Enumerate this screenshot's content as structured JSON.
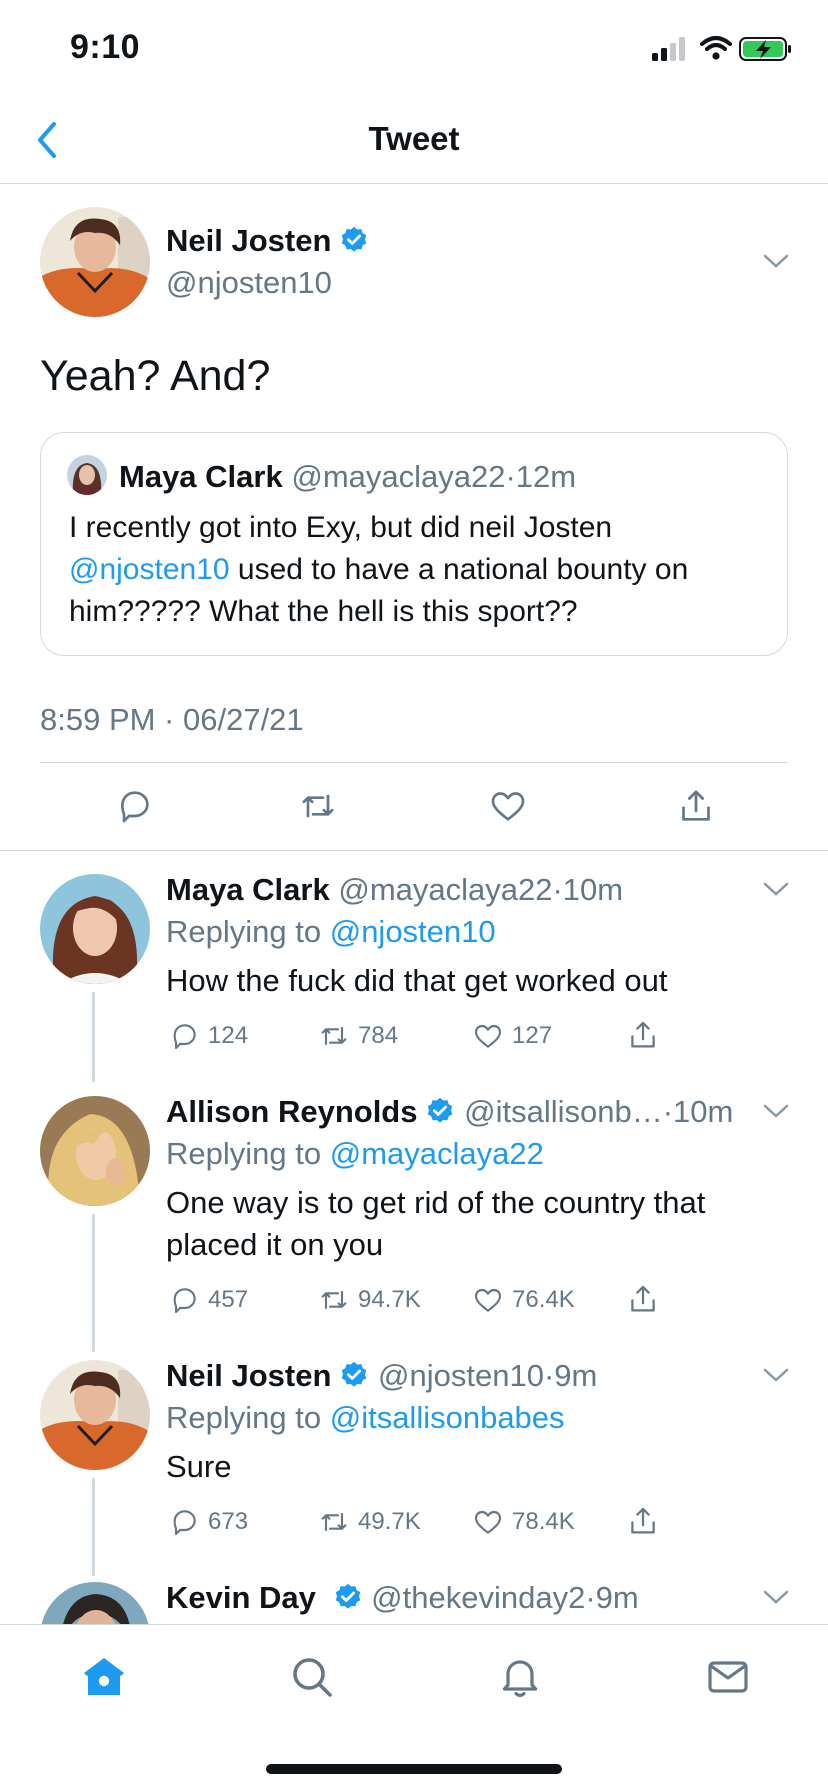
{
  "status_bar": {
    "time": "9:10"
  },
  "nav": {
    "title": "Tweet"
  },
  "main_tweet": {
    "author_name": "Neil Josten",
    "author_handle": "@njosten10",
    "text": "Yeah? And?",
    "quote": {
      "author_name": "Maya Clark",
      "author_handle": "@mayaclaya22",
      "time": "12m",
      "text_1": "I recently got into Exy, but did neil Josten",
      "mention": "@njosten10",
      "text_2": "used to have a national bounty on",
      "text_3": "him????? What the hell is this sport??"
    },
    "timestamp": "8:59 PM · 06/27/21"
  },
  "replies": [
    {
      "author_name": "Maya Clark",
      "author_handle": "@mayaclaya22",
      "time": "10m",
      "replying_prefix": "Replying to",
      "replying_to": "@njosten10",
      "text": "How the fuck did that get worked out",
      "comments": "124",
      "retweets": "784",
      "likes": "127"
    },
    {
      "author_name": "Allison Reynolds",
      "author_handle": "@itsallisonb…",
      "time": "10m",
      "replying_prefix": "Replying to",
      "replying_to": "@mayaclaya22",
      "text_1": "One way is to get rid of the country that",
      "text_2": "placed it on you",
      "comments": "457",
      "retweets": "94.7K",
      "likes": "76.4K"
    },
    {
      "author_name": "Neil Josten",
      "author_handle": "@njosten10",
      "time": "9m",
      "replying_prefix": "Replying to",
      "replying_to": "@itsallisonbabes",
      "text": "Sure",
      "comments": "673",
      "retweets": "49.7K",
      "likes": "78.4K"
    },
    {
      "author_name": "Kevin Day",
      "author_handle": "@thekevinday2",
      "time": "9m"
    }
  ],
  "sep": "·",
  "colors": {
    "accent": "#1d9bf0",
    "text": "#0f1419",
    "secondary": "#657786",
    "border": "#cfd9de"
  },
  "icons": [
    "back-icon",
    "verified-badge-icon",
    "chevron-down-icon",
    "reply-icon",
    "retweet-icon",
    "like-icon",
    "share-icon",
    "home-icon",
    "search-icon",
    "notifications-icon",
    "messages-icon"
  ]
}
